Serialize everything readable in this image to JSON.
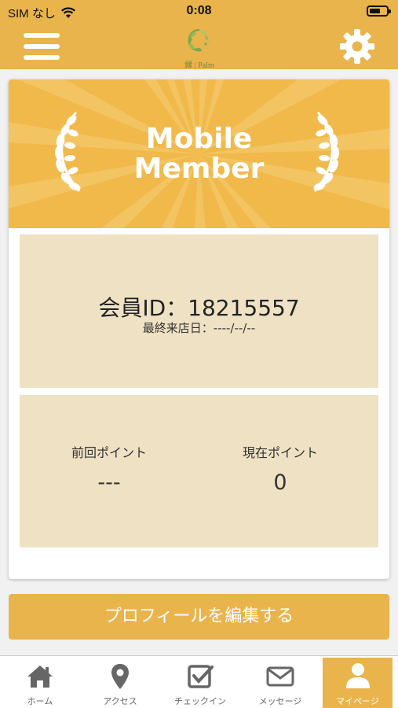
{
  "status_bar": {
    "carrier": "SIM なし",
    "time": "0:08"
  },
  "header": {
    "logo_text": "縁 | Palm"
  },
  "card": {
    "banner_title_line1": "Mobile",
    "banner_title_line2": "Member",
    "member_id_label": "会員ID",
    "member_id_separator": "：",
    "member_id": "18215557",
    "last_visit": "最終来店日：----/--/--",
    "prev_points_label": "前回ポイント",
    "prev_points_value": "---",
    "current_points_label": "現在ポイント",
    "current_points_value": "0"
  },
  "edit_profile_label": "プロフィールを編集する",
  "tabs": [
    {
      "label": "ホーム",
      "icon": "home-icon"
    },
    {
      "label": "アクセス",
      "icon": "map-pin-icon"
    },
    {
      "label": "チェックイン",
      "icon": "checkin-icon"
    },
    {
      "label": "メッセージ",
      "icon": "envelope-icon"
    },
    {
      "label": "マイページ",
      "icon": "user-icon",
      "active": true
    }
  ],
  "colors": {
    "accent": "#e9b44c",
    "panel": "#efe2c4",
    "tab_inactive": "#666666"
  }
}
